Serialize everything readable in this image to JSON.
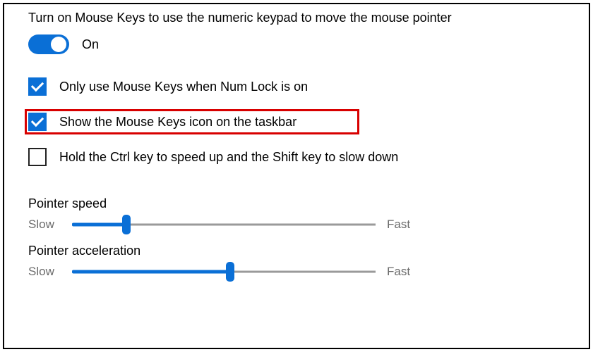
{
  "header": "Turn on Mouse Keys to use the numeric keypad to move the mouse pointer",
  "toggle": {
    "state_label": "On",
    "on": true
  },
  "checkboxes": [
    {
      "label": "Only use Mouse Keys when Num Lock is on",
      "checked": true
    },
    {
      "label": "Show the Mouse Keys icon on the taskbar",
      "checked": true,
      "highlighted": true
    },
    {
      "label": "Hold the Ctrl key to speed up and the Shift key to slow down",
      "checked": false
    }
  ],
  "sliders": {
    "speed": {
      "title": "Pointer speed",
      "low_label": "Slow",
      "high_label": "Fast",
      "value_percent": 18
    },
    "acceleration": {
      "title": "Pointer acceleration",
      "low_label": "Slow",
      "high_label": "Fast",
      "value_percent": 52
    }
  },
  "colors": {
    "accent": "#0a6fd6",
    "highlight_border": "#d80000"
  }
}
